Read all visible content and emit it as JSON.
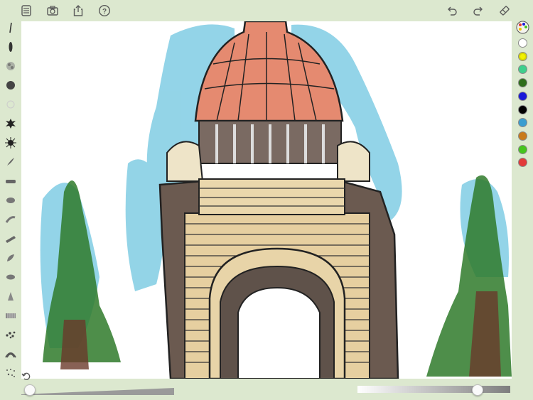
{
  "toolbar": {
    "left_icons": [
      "files-icon",
      "camera-icon",
      "share-icon",
      "help-icon"
    ],
    "help_label": "?",
    "right_icons": [
      "undo-icon",
      "redo-icon",
      "eraser-icon"
    ]
  },
  "brushes": [
    "pencil-brush",
    "marker-brush",
    "sponge-brush",
    "soft-round-brush",
    "outline-brush",
    "splat-brush",
    "spiky-brush",
    "feather-brush",
    "flat-brush",
    "oval-brush",
    "smudge-brush",
    "broad-brush",
    "leaf-brush",
    "dab-brush",
    "tuft-brush",
    "bristle-brush",
    "scatter-brush",
    "fan-brush",
    "speckle-brush"
  ],
  "palette": {
    "colors": [
      "#ffffff",
      "#f2f200",
      "#3ecf8c",
      "#2e6e1a",
      "#1a1ad8",
      "#000000",
      "#3a9ed0",
      "#c87a1a",
      "#46c41e",
      "#e23a3a"
    ],
    "selected": "#f2f200"
  },
  "sliders": {
    "brush_size": 0.05,
    "opacity": 0.78
  }
}
